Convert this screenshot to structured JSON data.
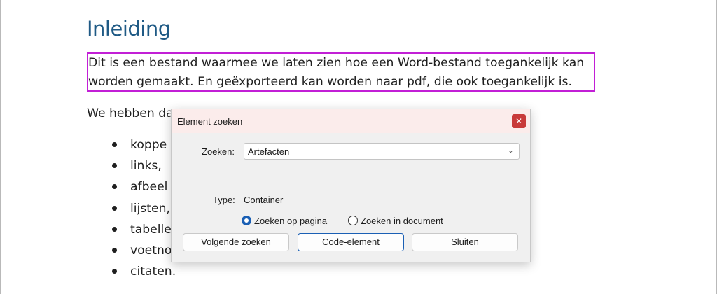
{
  "document": {
    "heading": "Inleiding",
    "intro_lines": [
      "Dit is een bestand waarmee we laten zien hoe een Word-bestand toegankelijk kan",
      "worden gemaakt. En geëxporteerd kan worden naar pdf, die ook toegankelijk is."
    ],
    "second_para": "We hebben da",
    "bullets": [
      "koppe",
      "links,",
      "afbeel",
      "lijsten,",
      "tabelle",
      "voetno",
      "citaten."
    ]
  },
  "dialog": {
    "title": "Element zoeken",
    "close_glyph": "✕",
    "search_label": "Zoeken:",
    "search_value": "Artefacten",
    "type_label": "Type:",
    "type_value": "Container",
    "radio_page": "Zoeken op pagina",
    "radio_doc": "Zoeken in document",
    "selected_scope": "Zoeken op pagina",
    "btn_next": "Volgende zoeken",
    "btn_code": "Code-element",
    "btn_close": "Sluiten"
  },
  "colors": {
    "heading": "#1f5a85",
    "highlight_border": "#c21fd6",
    "close_button": "#c83a3a",
    "accent": "#1a5fb4"
  },
  "icons": {
    "close": "close-icon",
    "dropdown": "chevron-down-icon"
  }
}
